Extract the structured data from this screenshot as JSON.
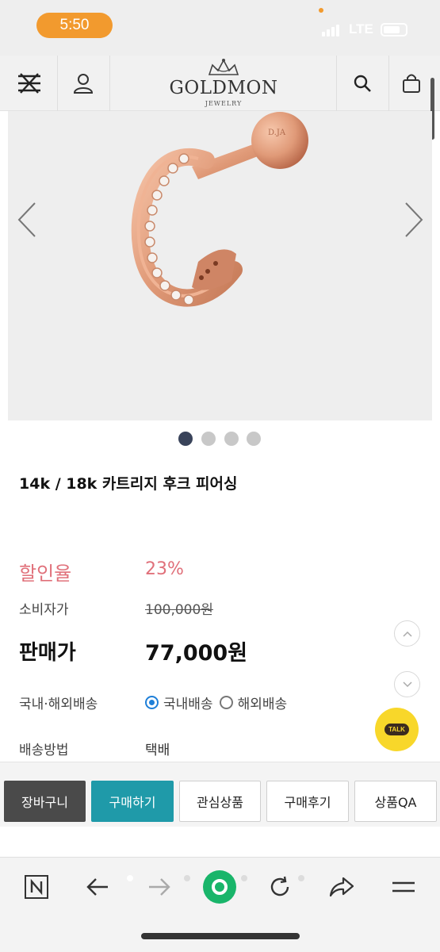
{
  "status": {
    "time": "5:50",
    "network": "LTE"
  },
  "header": {
    "brand": "GOLDMON",
    "brand_sub": "JEWELRY"
  },
  "icons": {
    "menu": "menu-close-icon",
    "user": "user-icon",
    "search": "search-icon",
    "bag": "shopping-bag-icon"
  },
  "gallery": {
    "image": "rose-gold-cartilage-hoop-piercing",
    "engraving": "D.JA",
    "dot_count": 4,
    "active_dot": 0
  },
  "product": {
    "title": "14k / 18k 카트리지 후크 피어싱",
    "discount_label": "할인율",
    "discount_value": "23%",
    "consumer_price_label": "소비자가",
    "consumer_price": "100,000원",
    "sale_price_label": "판매가",
    "sale_price": "77,000원",
    "shipping_label": "국내·해외배송",
    "shipping_options": [
      "국내배송",
      "해외배송"
    ],
    "shipping_selected": "국내배송",
    "method_label": "배송방법",
    "method_value": "택배"
  },
  "floating": {
    "talk_label": "TALK"
  },
  "actions": {
    "cart": "장바구니",
    "buy": "구매하기",
    "wishlist": "관심상품",
    "review": "구매후기",
    "qa": "상품QA"
  },
  "browser_toolbar": {
    "icons": [
      "naver-n-icon",
      "back-arrow-icon",
      "forward-arrow-icon",
      "green-home-icon",
      "reload-icon",
      "share-icon",
      "menu-icon"
    ]
  },
  "colors": {
    "accent_discount": "#e0707a",
    "buy_button": "#1f9aa9",
    "cart_button": "#4a4a4a",
    "talk_yellow": "#f8d72a",
    "time_pill": "#f29a2e"
  }
}
